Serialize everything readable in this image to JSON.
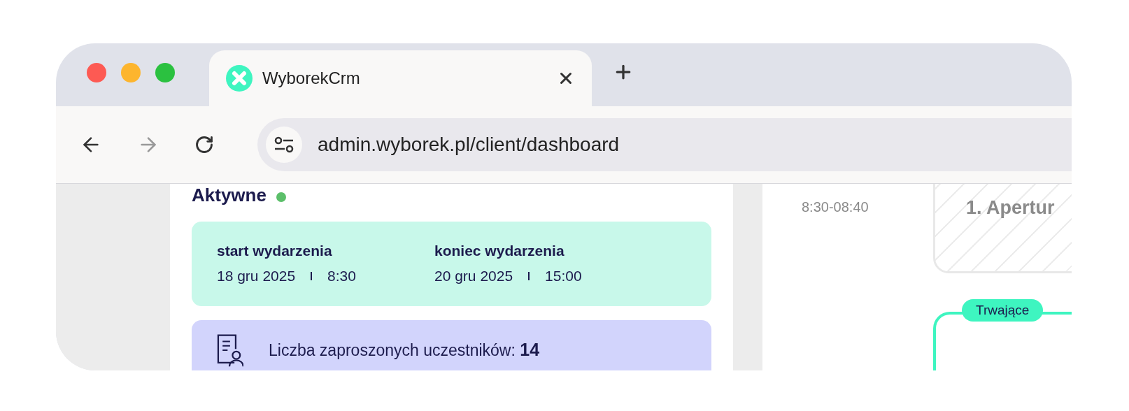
{
  "browser": {
    "tabs": [
      {
        "title": "WyborekCrm",
        "selected": true
      }
    ],
    "url": "admin.wyborek.pl/client/dashboard"
  },
  "event": {
    "status": "Aktywne",
    "dates": [
      {
        "label": "start wydarzenia",
        "date": "18 gru 2025",
        "time": "8:30"
      },
      {
        "label": "koniec wydarzenia",
        "date": "20 gru 2025",
        "time": "15:00"
      }
    ],
    "participants": "Liczba zaproszonych uczestników: **14**"
  },
  "agenda": [
    {
      "kind": "past",
      "time": "8:30-08:40",
      "title": "1. Apertur"
    },
    {
      "kind": "current",
      "badge": "Trwające"
    }
  ]
}
